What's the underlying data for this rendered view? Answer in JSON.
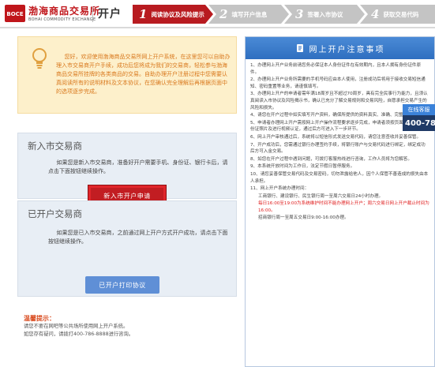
{
  "header": {
    "logo_text": "BOCE",
    "brand_cn": "渤海商品交易所",
    "brand_en": "BOHAI COMMODITY EXCHANGE",
    "page_title": "开户",
    "steps": [
      {
        "num": "1",
        "label": "阅读协议及风险提示",
        "color": "#b81b20"
      },
      {
        "num": "2",
        "label": "填写开户信息",
        "color": "#c0c0c0"
      },
      {
        "num": "3",
        "label": "签署入市协议",
        "color": "#c0c0c0"
      },
      {
        "num": "4",
        "label": "获取交易代码",
        "color": "#c0c0c0"
      }
    ]
  },
  "welcome": {
    "text": "您好，欢迎使用渤海商品交易所网上开户系统，在这里您可以自助办理入市交易商开户手续，成功后您将成为我们的交易商，轻松参与渤海商品交易所挂牌的各类商品的交易。自助办理开户注册过程中您需要认真阅读所有的说明材料及文本协议，在您确认完全理解后再根据页面中的选项逐步完成。"
  },
  "new_trader": {
    "title": "新入市交易商",
    "desc": "如果您是新入市交易商，准备好开户需要手机、身份证、银行卡后，请点击下面按钮继续操作。",
    "button": "新入市开户申请"
  },
  "existing_trader": {
    "title": "已开户交易商",
    "desc": "如果您是已入市交易商，之前通过网上开户方式开户成功，请点击下面按钮继续操作。",
    "button": "已开户打印协议"
  },
  "tips": {
    "title": "温馨提示：",
    "lines": [
      "请您不要在网吧等公共场所使用网上开户系统。",
      "如您存有疑问，请拨打400-786-8888进行咨询。"
    ]
  },
  "notice": {
    "title": "网上开户注意事项",
    "items": [
      "1、办理网上开户业务前请您务必保证本人身份证件在有效期内，且本人拥有身份证件原件。",
      "2、办理网上开户业务所需要的手机号码应由本人使用，注册成功后将用于接收交易短信通知、密码重置等业务，请谨慎填写。",
      "3、办理网上开户的申请者需年满18周岁且不超过70周岁，具有完全民事行为能力，且须认真阅读入市协议及风险揭示书，确认已充分了解交易规则和交易风险，自愿承担交易产生的风险和损失。",
      "4、请您在开户过程中如实填写开户资料，确保所提供的资料真实、准确、完整、有效。",
      "5、申请者办理网上开户需按网上开户操作流程要求逐步完成，申请者须按页面提示上传身份证照片及进行视频认证，通过后方可进入下一步环节。",
      "6、网上开户审核通过后，系统将以短信形式发送交易代码，请您注意查收并妥善保管。",
      "7、开户成功后，您需通过银行办理签约手续，将银行账户与交易代码进行绑定，绑定成功后方可入金交易。",
      "8、如您在开户过程中遇到问题，可拨打客服热线进行咨询，工作人员将为您解答。",
      "9、本系统开放时间为工作日，法定节假日暂停服务。",
      "10、请您妥善保管交易代码及交易密码，切勿泄露给他人，因个人保管不善造成的损失由本人承担。",
      "11、网上开户系统办理时间：",
      "工商银行、建设银行、民生银行周一至周六交易日24小时办理。",
      "每日16:00至19:00为系统维护时间不能办理网上开户；周六交易日网上开户截止时间为16:00。",
      "招商银行周一至周五交易日9:00-16:00办理。"
    ]
  },
  "online_service": {
    "label": "在线客服",
    "phone": "400-78"
  },
  "colors": {
    "brand_red": "#c0161b",
    "accent_blue": "#3b82d9",
    "welcome_bg": "#fdf0cb",
    "welcome_text": "#d9791e"
  }
}
